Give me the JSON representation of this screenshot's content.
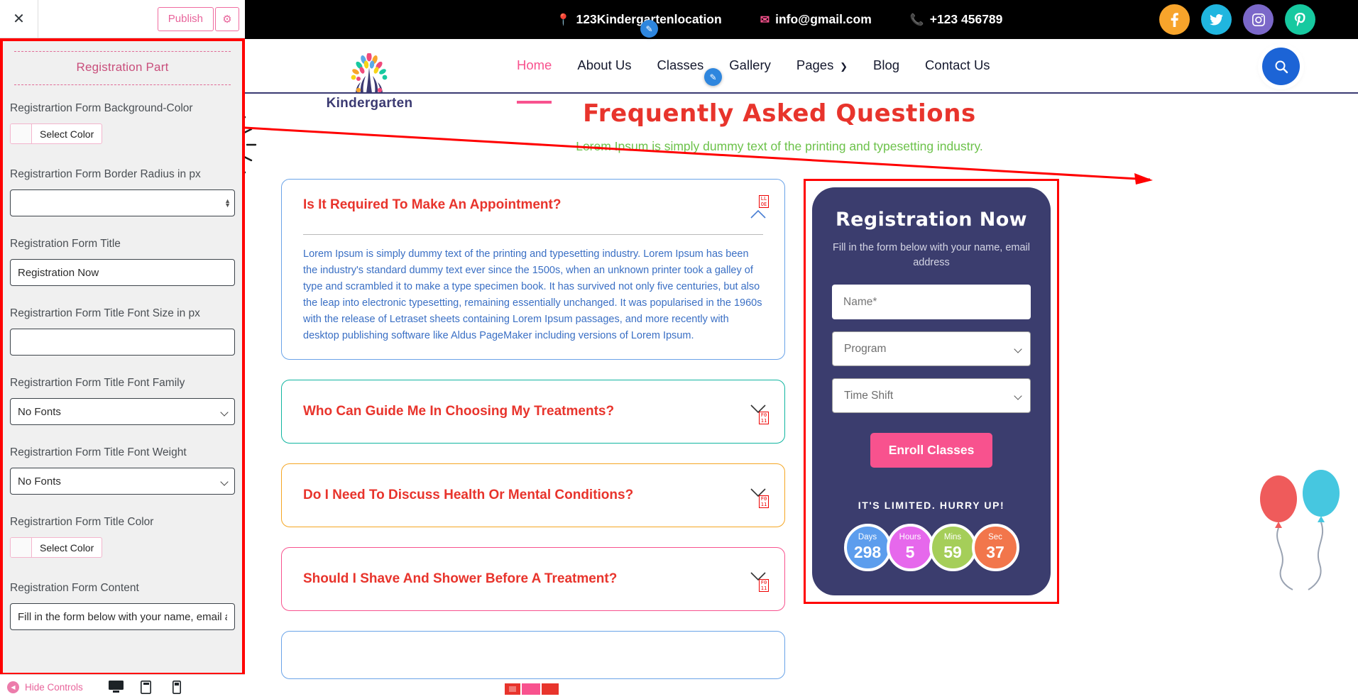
{
  "customizer": {
    "close_icon": "✕",
    "publish_label": "Publish",
    "gear_icon": "⚙",
    "section_title": "Registration Part",
    "fields": [
      {
        "label": "Registrartion Form Background-Color",
        "type": "color",
        "button_label": "Select Color",
        "swatch": "#fafafa"
      },
      {
        "label": "Registrartion Form Border Radius in px",
        "type": "number",
        "value": ""
      },
      {
        "label": "Registration Form Title",
        "type": "text",
        "value": "Registration Now"
      },
      {
        "label": "Registrartion Form Title Font Size in px",
        "type": "text",
        "value": ""
      },
      {
        "label": "Registrartion Form Title Font Family",
        "type": "select",
        "value": "No Fonts"
      },
      {
        "label": "Registrartion Form Title Font Weight",
        "type": "select",
        "value": "No Fonts"
      },
      {
        "label": "Registrartion Form Title Color",
        "type": "color",
        "button_label": "Select Color",
        "swatch": "#fafafa"
      },
      {
        "label": "Registration Form Content",
        "type": "text",
        "value": "Fill in the form below with your name, email addres"
      }
    ],
    "footer": {
      "hide_label": "Hide Controls",
      "back_icon": "◀",
      "devices": [
        "desktop-icon",
        "tablet-icon",
        "mobile-icon"
      ]
    }
  },
  "site": {
    "topbar": {
      "location": "123Kindergartenlocation",
      "email": "info@gmail.com",
      "phone": "+123 456789",
      "location_icon": "location-pin-icon",
      "email_icon": "envelope-icon",
      "phone_icon": "phone-icon",
      "social": [
        {
          "name": "facebook-icon",
          "glyph": "f",
          "color": "#f7a42b"
        },
        {
          "name": "twitter-icon",
          "glyph": "🐦",
          "color": "#20b6df"
        },
        {
          "name": "instagram-icon",
          "glyph": "◙",
          "color": "#7b68c9"
        },
        {
          "name": "pinterest-icon",
          "glyph": "P",
          "color": "#17c9a0"
        }
      ]
    },
    "nav": {
      "logo_text": "Kindergarten",
      "items": [
        {
          "label": "Home",
          "active": true
        },
        {
          "label": "About Us",
          "active": false
        },
        {
          "label": "Classes",
          "active": false
        },
        {
          "label": "Gallery",
          "active": false
        },
        {
          "label": "Pages",
          "active": false,
          "caret": true
        },
        {
          "label": "Blog",
          "active": false
        },
        {
          "label": "Contact Us",
          "active": false
        }
      ],
      "search_icon": "search-icon"
    },
    "faq": {
      "title": "Frequently Asked Questions",
      "subtitle": "Lorem Ipsum is simply dummy text of the printing and typesetting industry.",
      "items": [
        {
          "question": "Is It Required To Make An Appointment?",
          "expanded": true,
          "answer": "Lorem Ipsum is simply dummy text of the printing and typesetting industry. Lorem Ipsum has been the industry's standard dummy text ever since the 1500s, when an unknown printer took a galley of type and scrambled it to make a type specimen book. It has survived not only five centuries, but also the leap into electronic typesetting, remaining essentially unchanged. It was popularised in the 1960s with the release of Letraset sheets containing Lorem Ipsum passages, and more recently with desktop publishing software like Aldus PageMaker including versions of Lorem Ipsum.",
          "color": "blue"
        },
        {
          "question": "Who Can Guide Me In Choosing My Treatments?",
          "expanded": false,
          "answer": "",
          "color": "teal"
        },
        {
          "question": "Do I Need To Discuss Health Or Mental Conditions?",
          "expanded": false,
          "answer": "",
          "color": "orange"
        },
        {
          "question": "Should I Shave And Shower Before A Treatment?",
          "expanded": false,
          "answer": "",
          "color": "pink"
        },
        {
          "question": "",
          "expanded": false,
          "answer": "",
          "color": "blue2"
        }
      ]
    },
    "registration": {
      "title": "Registration Now",
      "subtitle": "Fill in the form below with your name, email address",
      "name_placeholder": "Name*",
      "program_value": "Program",
      "timeshift_value": "Time Shift",
      "button_label": "Enroll Classes",
      "limited_text": "IT'S LIMITED. HURRY UP!",
      "counters": [
        {
          "label": "Days",
          "value": "298",
          "color": "#5c9ded"
        },
        {
          "label": "Hours",
          "value": "5",
          "color": "#e668ec"
        },
        {
          "label": "Mins",
          "value": "59",
          "color": "#a5ce59"
        },
        {
          "label": "Sec",
          "value": "37",
          "color": "#f2764b"
        }
      ]
    }
  }
}
